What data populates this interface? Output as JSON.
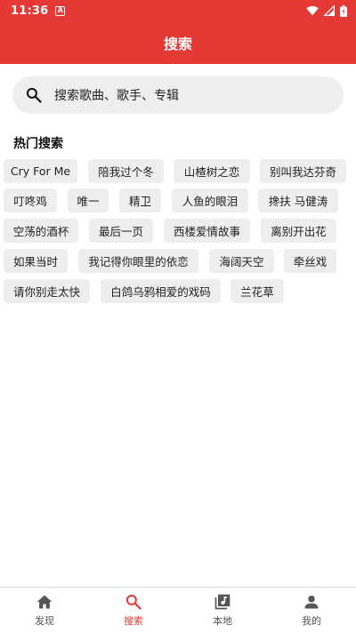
{
  "status_bar": {
    "time": "11:36",
    "notif_letter": "A"
  },
  "app_bar": {
    "title": "搜索"
  },
  "search": {
    "placeholder": "搜索歌曲、歌手、专辑"
  },
  "hot_search": {
    "title": "热门搜索",
    "tags": [
      "Cry For Me",
      "陪我过个冬",
      "山楂树之恋",
      "别叫我达芬奇",
      "叮咚鸡",
      "唯一",
      "精卫",
      "人鱼的眼泪",
      "搀扶 马健涛",
      "空荡的酒杯",
      "最后一页",
      "西楼爱情故事",
      "离别开出花",
      "如果当时",
      "我记得你眼里的依恋",
      "海阔天空",
      "牵丝戏",
      "请你别走太快",
      "白鸽乌鸦相爱的戏码",
      "兰花草"
    ]
  },
  "bottom_nav": {
    "items": [
      {
        "label": "发现",
        "icon": "home-icon"
      },
      {
        "label": "搜索",
        "icon": "search-icon",
        "active": true
      },
      {
        "label": "本地",
        "icon": "library-music-icon"
      },
      {
        "label": "我的",
        "icon": "person-icon"
      }
    ]
  },
  "colors": {
    "accent": "#e53935",
    "tag_bg": "#eeeeee",
    "search_bg": "#eeeeee"
  }
}
